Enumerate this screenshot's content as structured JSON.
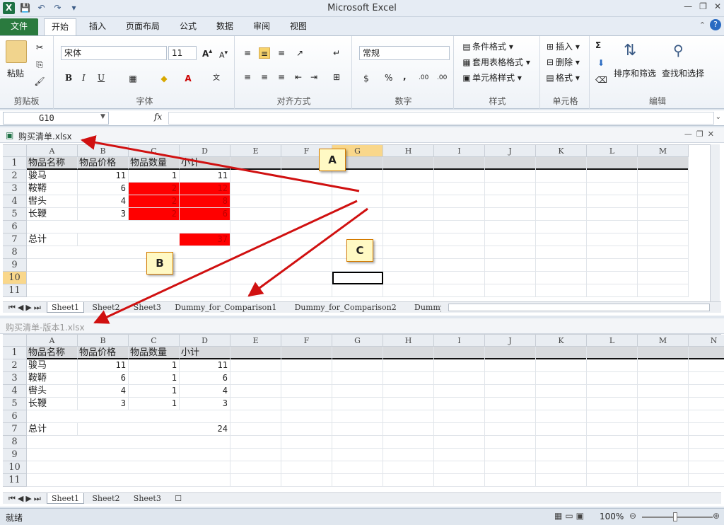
{
  "window": {
    "title": "Microsoft Excel"
  },
  "tabs": [
    "文件",
    "开始",
    "插入",
    "页面布局",
    "公式",
    "数据",
    "审阅",
    "视图"
  ],
  "ribbon": {
    "font_name": "宋体",
    "font_size": "11",
    "number_format": "常规",
    "groups": {
      "clipboard": "剪贴板",
      "font": "字体",
      "align": "对齐方式",
      "number": "数字",
      "styles": "样式",
      "cells": "单元格",
      "editing": "编辑"
    },
    "paste": "粘贴",
    "cond_format": "条件格式",
    "table_format": "套用表格格式",
    "cell_style": "单元格样式",
    "insert": "插入",
    "delete": "删除",
    "format": "格式",
    "sort": "排序和筛选",
    "find": "查找和选择",
    "sum_symbol": "Σ",
    "pct": "%",
    "comma": ",",
    "dec_inc": ".00",
    "bold": "B",
    "italic": "I",
    "underline": "U"
  },
  "formula_bar": {
    "name_box": "G10",
    "fx": "fx",
    "value": ""
  },
  "top_workbook": {
    "title": "购买清单.xlsx",
    "columns": [
      "A",
      "B",
      "C",
      "D",
      "E",
      "F",
      "G",
      "H",
      "I",
      "J",
      "K",
      "L",
      "M"
    ],
    "rows": [
      "1",
      "2",
      "3",
      "4",
      "5",
      "6",
      "7",
      "8",
      "9",
      "10",
      "11"
    ],
    "header": [
      "物品名称",
      "物品价格",
      "物品数量",
      "小计"
    ],
    "data": [
      [
        "骏马",
        "11",
        "1",
        "11"
      ],
      [
        "鞍鞯",
        "6",
        "2",
        "12"
      ],
      [
        "辔头",
        "4",
        "2",
        "8"
      ],
      [
        "长鞭",
        "3",
        "2",
        "6"
      ]
    ],
    "total_label": "总计",
    "total_value": "37",
    "sheets": [
      "Sheet1",
      "Sheet2",
      "Sheet3",
      "Dummy_for_Comparison1",
      "Dummy_for_Comparison2",
      "Dummy"
    ]
  },
  "bottom_workbook": {
    "title": "购买清单-版本1.xlsx",
    "columns": [
      "A",
      "B",
      "C",
      "D",
      "E",
      "F",
      "G",
      "H",
      "I",
      "J",
      "K",
      "L",
      "M",
      "N"
    ],
    "rows": [
      "1",
      "2",
      "3",
      "4",
      "5",
      "6",
      "7",
      "8",
      "9",
      "10",
      "11"
    ],
    "header": [
      "物品名称",
      "物品价格",
      "物品数量",
      "小计"
    ],
    "data": [
      [
        "骏马",
        "11",
        "1",
        "11"
      ],
      [
        "鞍鞯",
        "6",
        "1",
        "6"
      ],
      [
        "辔头",
        "4",
        "1",
        "4"
      ],
      [
        "长鞭",
        "3",
        "1",
        "3"
      ]
    ],
    "total_label": "总计",
    "total_value": "24",
    "sheets": [
      "Sheet1",
      "Sheet2",
      "Sheet3"
    ]
  },
  "callouts": [
    "A",
    "B",
    "C"
  ],
  "status": {
    "ready": "就绪",
    "zoom": "100%"
  },
  "colors": {
    "highlight_red": "#ff0000",
    "file_tab": "#2a7a3e",
    "arrow": "#d01010",
    "callout_bg": "#fff9c4"
  }
}
